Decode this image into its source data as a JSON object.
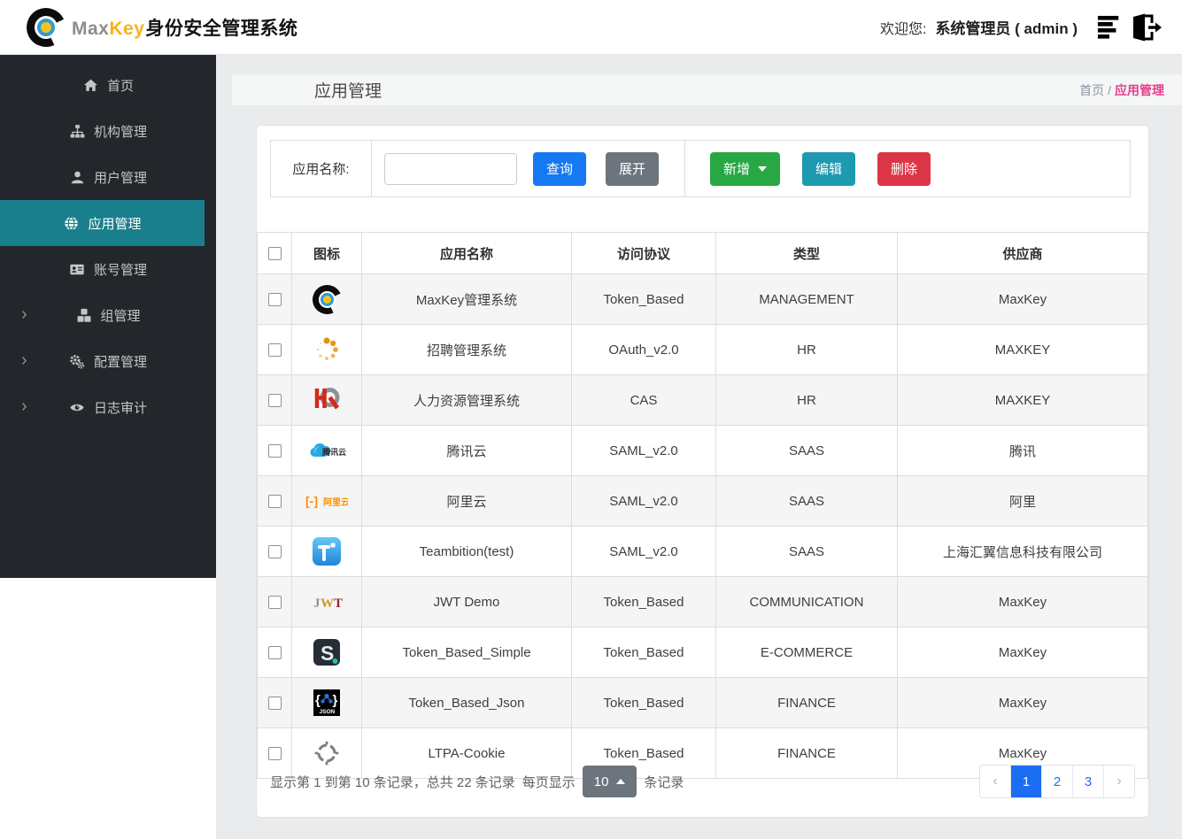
{
  "topbar": {
    "brand": {
      "max": "Max",
      "key": "Key",
      "suffix": "身份安全管理系统",
      "logo_icon": "maxkey-logo-icon"
    },
    "welcome_label": "欢迎您:",
    "user": "系统管理员 ( admin )",
    "icons": [
      "list-icon",
      "logout-icon"
    ]
  },
  "sidebar": {
    "items": [
      {
        "key": "home",
        "label": "首页",
        "icon": "home-icon",
        "active": false,
        "expandable": false
      },
      {
        "key": "org",
        "label": "机构管理",
        "icon": "sitemap-icon",
        "active": false,
        "expandable": false
      },
      {
        "key": "user",
        "label": "用户管理",
        "icon": "user-icon",
        "active": false,
        "expandable": false
      },
      {
        "key": "app",
        "label": "应用管理",
        "icon": "globe-icon",
        "active": true,
        "expandable": false
      },
      {
        "key": "account",
        "label": "账号管理",
        "icon": "id-card-icon",
        "active": false,
        "expandable": false
      },
      {
        "key": "group",
        "label": "组管理",
        "icon": "cubes-icon",
        "active": false,
        "expandable": true
      },
      {
        "key": "config",
        "label": "配置管理",
        "icon": "gears-icon",
        "active": false,
        "expandable": true
      },
      {
        "key": "audit",
        "label": "日志审计",
        "icon": "eye-icon",
        "active": false,
        "expandable": true
      }
    ]
  },
  "page": {
    "title": "应用管理",
    "breadcrumb": {
      "root": "首页",
      "separator": "/",
      "current": "应用管理"
    }
  },
  "search": {
    "label": "应用名称:",
    "input_value": "",
    "query_label": "查询",
    "expand_label": "展开",
    "add_label": "新增",
    "edit_label": "编辑",
    "delete_label": "删除"
  },
  "table": {
    "columns": [
      "图标",
      "应用名称",
      "访问协议",
      "类型",
      "供应商"
    ],
    "rows": [
      {
        "icon": "maxkey-logo-icon",
        "name": "MaxKey管理系统",
        "protocol": "Token_Based",
        "type": "MANAGEMENT",
        "vendor": "MaxKey"
      },
      {
        "icon": "spinner-dots-icon",
        "name": "招聘管理系统",
        "protocol": "OAuth_v2.0",
        "type": "HR",
        "vendor": "MAXKEY"
      },
      {
        "icon": "hr-logo-icon",
        "name": "人力资源管理系统",
        "protocol": "CAS",
        "type": "HR",
        "vendor": "MAXKEY"
      },
      {
        "icon": "tencent-cloud-icon",
        "name": "腾讯云",
        "protocol": "SAML_v2.0",
        "type": "SAAS",
        "vendor": "腾讯"
      },
      {
        "icon": "aliyun-icon",
        "name": "阿里云",
        "protocol": "SAML_v2.0",
        "type": "SAAS",
        "vendor": "阿里"
      },
      {
        "icon": "teambition-icon",
        "name": "Teambition(test)",
        "protocol": "SAML_v2.0",
        "type": "SAAS",
        "vendor": "上海汇翼信息科技有限公司"
      },
      {
        "icon": "jwt-icon",
        "name": "JWT Demo",
        "protocol": "Token_Based",
        "type": "COMMUNICATION",
        "vendor": "MaxKey"
      },
      {
        "icon": "s-logo-icon",
        "name": "Token_Based_Simple",
        "protocol": "Token_Based",
        "type": "E-COMMERCE",
        "vendor": "MaxKey"
      },
      {
        "icon": "json-logo-icon",
        "name": "Token_Based_Json",
        "protocol": "Token_Based",
        "type": "FINANCE",
        "vendor": "MaxKey"
      },
      {
        "icon": "ltpa-target-icon",
        "name": "LTPA-Cookie",
        "protocol": "Token_Based",
        "type": "FINANCE",
        "vendor": "MaxKey"
      }
    ]
  },
  "pagination": {
    "summary": "显示第 1 到第 10 条记录，总共 22 条记录",
    "per_page_label": "每页显示",
    "per_page_value": "10",
    "per_page_suffix": "条记录",
    "prev_label": "‹",
    "next_label": "›",
    "pages": [
      "1",
      "2",
      "3"
    ],
    "active_page": "1"
  },
  "colors": {
    "sidebar_bg": "#23272b",
    "active_teal": "#1a7f8c",
    "primary_blue": "#1678f2",
    "success_green": "#28a745",
    "info_teal": "#1e9ab0",
    "danger_red": "#dc3545",
    "secondary_gray": "#6c757d",
    "breadcrumb_pink": "#e83e8c",
    "brand_yellow": "#f5b31a",
    "pager_blue": "#1b6ef3",
    "stripe_gray": "#f5f5f5"
  }
}
